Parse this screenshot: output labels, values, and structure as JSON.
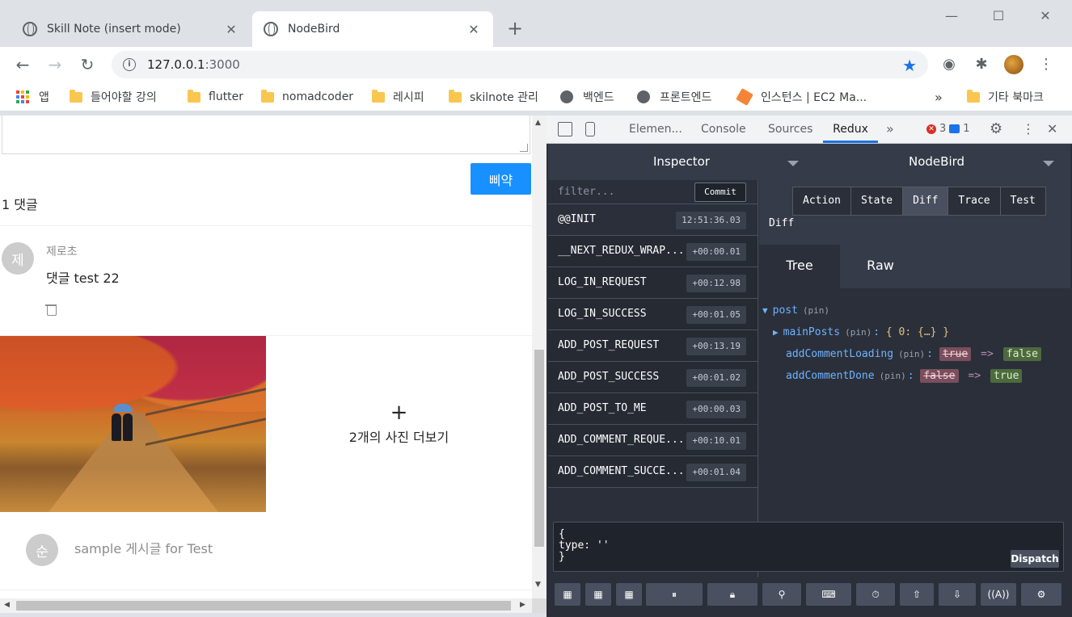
{
  "browser": {
    "tabs": [
      {
        "title": "Skill Note (insert mode)",
        "active": false
      },
      {
        "title": "NodeBird",
        "active": true
      }
    ],
    "new_tab": "+",
    "url_host": "127.0.0.1",
    "url_port": ":3000",
    "bookmarks": [
      {
        "label": "앱",
        "icon": "apps-grid-icon"
      },
      {
        "label": "들어야할 강의",
        "icon": "folder-icon"
      },
      {
        "label": "flutter",
        "icon": "folder-icon"
      },
      {
        "label": "nomadcoder",
        "icon": "folder-icon"
      },
      {
        "label": "레시피",
        "icon": "folder-icon"
      },
      {
        "label": "skilnote 관리",
        "icon": "folder-icon"
      },
      {
        "label": "백엔드",
        "icon": "globe-icon"
      },
      {
        "label": "프론트엔드",
        "icon": "globe-icon"
      },
      {
        "label": "인스턴스 | EC2 Ma...",
        "icon": "aws-icon"
      }
    ],
    "bookmarks_more": "»",
    "other_bookmarks": "기타 북마크"
  },
  "page": {
    "tweet_button": "삐약",
    "comment_count": "1 댓글",
    "comment": {
      "avatar": "제",
      "author": "제로초",
      "text": "댓글 test 22"
    },
    "more_photos": {
      "plus": "+",
      "label": "2개의 사진 더보기"
    },
    "post": {
      "avatar": "순",
      "text": "sample 게시글 for Test"
    }
  },
  "devtools": {
    "tabs": [
      "Elemen...",
      "Console",
      "Sources",
      "Redux"
    ],
    "active_tab": "Redux",
    "more_tabs": "»",
    "errors": "3",
    "messages": "1",
    "redux": {
      "inspector": "Inspector",
      "instance": "NodeBird",
      "filter_placeholder": "filter...",
      "commit": "Commit",
      "actions": [
        {
          "name": "@@INIT",
          "time": "12:51:36.03"
        },
        {
          "name": "__NEXT_REDUX_WRAP...",
          "time": "+00:00.01"
        },
        {
          "name": "LOG_IN_REQUEST",
          "time": "+00:12.98"
        },
        {
          "name": "LOG_IN_SUCCESS",
          "time": "+00:01.05"
        },
        {
          "name": "ADD_POST_REQUEST",
          "time": "+00:13.19"
        },
        {
          "name": "ADD_POST_SUCCESS",
          "time": "+00:01.02"
        },
        {
          "name": "ADD_POST_TO_ME",
          "time": "+00:00.03"
        },
        {
          "name": "ADD_COMMENT_REQUE...",
          "time": "+00:10.01"
        },
        {
          "name": "ADD_COMMENT_SUCCE...",
          "time": "+00:01.04"
        }
      ],
      "monitor_tabs": [
        "Action",
        "State",
        "Diff",
        "Trace",
        "Test"
      ],
      "active_monitor": "Diff",
      "section_label": "Diff",
      "view_tabs": [
        "Tree",
        "Raw"
      ],
      "active_view": "Tree",
      "tree": {
        "root_key": "post",
        "pin": "(pin)",
        "main_posts_key": "mainPosts",
        "main_posts_value": "{ 0: {…} }",
        "loading_key": "addCommentLoading",
        "loading_old": "true",
        "loading_new": "false",
        "done_key": "addCommentDone",
        "done_old": "false",
        "done_new": "true",
        "arrow": "=>"
      },
      "dispatch_text": "{\ntype: ''\n}",
      "dispatch_button": "Dispatch"
    }
  },
  "colors": {
    "accent": "#1890ff",
    "devtools_bg": "#2a2f3a",
    "redux_key": "#6fb3ff"
  }
}
